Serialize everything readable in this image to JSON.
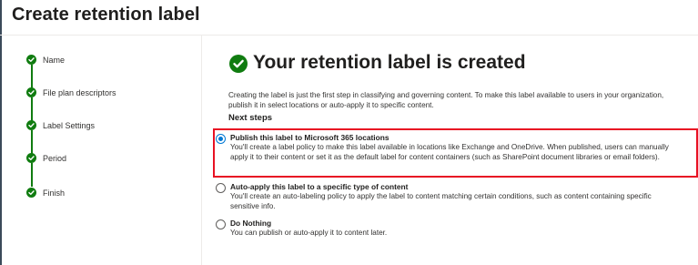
{
  "page": {
    "title": "Create retention label"
  },
  "steps": [
    {
      "label": "Name"
    },
    {
      "label": "File plan descriptors"
    },
    {
      "label": "Label Settings"
    },
    {
      "label": "Period"
    },
    {
      "label": "Finish"
    }
  ],
  "main": {
    "heading": "Your retention label is created",
    "intro": "Creating the label is just the first step in classifying and governing content. To make this label available to users in your organization, publish it in select locations or auto-apply it to specific content.",
    "next_steps_label": "Next steps",
    "options": [
      {
        "title": "Publish this label to Microsoft 365 locations",
        "description": "You'll create a label policy to make this label available in locations like Exchange and OneDrive. When published, users can manually apply it to their content or set it as the default label for content containers (such as SharePoint document libraries or email folders).",
        "selected": true
      },
      {
        "title": "Auto-apply this label to a specific type of content",
        "description": "You'll create an auto-labeling policy to apply the label to content matching certain conditions, such as content containing specific sensitive info.",
        "selected": false
      },
      {
        "title": "Do Nothing",
        "description": "You can publish or auto-apply it to content later.",
        "selected": false
      }
    ]
  },
  "colors": {
    "success": "#107c10",
    "accent": "#0078d4",
    "highlight": "#e81123"
  }
}
